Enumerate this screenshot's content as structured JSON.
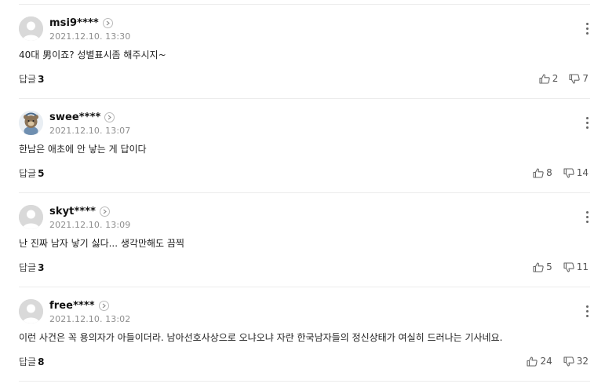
{
  "labels": {
    "reply": "답글"
  },
  "comments": [
    {
      "user": "msi9****",
      "date": "2021.12.10. 13:30",
      "text": "40대 男이죠? 성별표시좀 해주시지~",
      "replies": "3",
      "likes": "2",
      "dislikes": "7",
      "avatar": "default"
    },
    {
      "user": "swee****",
      "date": "2021.12.10. 13:07",
      "text": "한남은 애초에 안 낳는 게 답이다",
      "replies": "5",
      "likes": "8",
      "dislikes": "14",
      "avatar": "character"
    },
    {
      "user": "skyt****",
      "date": "2021.12.10. 13:09",
      "text": "난 진짜 남자 낳기 싫다... 생각만해도 끔찍",
      "replies": "3",
      "likes": "5",
      "dislikes": "11",
      "avatar": "default"
    },
    {
      "user": "free****",
      "date": "2021.12.10. 13:02",
      "text": "이런 사건은 꼭 용의자가 아들이더라. 남아선호사상으로 오냐오냐 자란 한국남자들의 정신상태가 여실히 드러나는 기사네요.",
      "replies": "8",
      "likes": "24",
      "dislikes": "32",
      "avatar": "default"
    }
  ],
  "icons": {
    "avatar": "default-profile-icon",
    "profile_more": "chevron-right-icon",
    "menu": "more-vertical-icon",
    "like": "thumbs-up-icon",
    "dislike": "thumbs-down-icon"
  },
  "colors": {
    "separator": "#ececec",
    "date": "#8e8e8e",
    "text": "#222222",
    "avatar_bg": "#d9d9d9"
  }
}
